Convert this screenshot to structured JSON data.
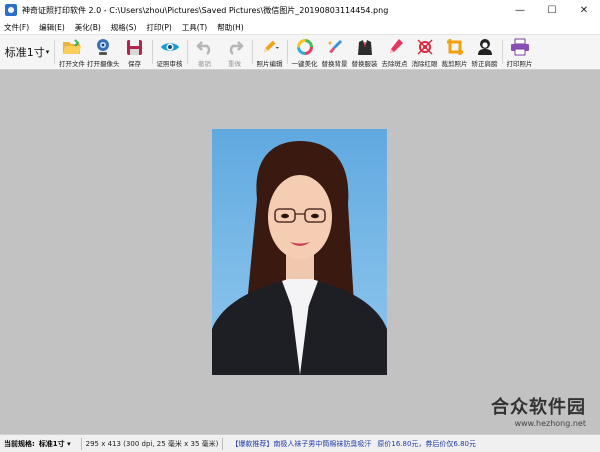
{
  "window": {
    "title": "神奇证照打印软件 2.0 - C:\\Users\\zhou\\Pictures\\Saved Pictures\\微信图片_20190803114454.png",
    "minimize": "—",
    "maximize": "☐",
    "close": "✕"
  },
  "menu": {
    "items": [
      "文件(F)",
      "编辑(E)",
      "美化(B)",
      "规格(S)",
      "打印(P)",
      "工具(T)",
      "帮助(H)"
    ]
  },
  "toolbar": {
    "size_value": "标准1寸",
    "buttons": [
      {
        "label": "打开文件",
        "icon": "folder-open-icon",
        "enabled": true
      },
      {
        "label": "打开摄像头",
        "icon": "webcam-icon",
        "enabled": true
      },
      {
        "label": "保存",
        "icon": "save-disk-icon",
        "enabled": true
      },
      {
        "label": "证照审核",
        "icon": "eye-icon",
        "enabled": true
      },
      {
        "label": "撤销",
        "icon": "undo-icon",
        "enabled": false
      },
      {
        "label": "重做",
        "icon": "redo-icon",
        "enabled": false
      },
      {
        "label": "照片编辑",
        "icon": "pencil-icon",
        "enabled": true
      },
      {
        "label": "一键美化",
        "icon": "color-ring-icon",
        "enabled": true
      },
      {
        "label": "替换背景",
        "icon": "paint-brush-icon",
        "enabled": true
      },
      {
        "label": "替换服装",
        "icon": "suit-icon",
        "enabled": true
      },
      {
        "label": "去除斑点",
        "icon": "pen-icon",
        "enabled": true
      },
      {
        "label": "消除红眼",
        "icon": "red-eye-icon",
        "enabled": true
      },
      {
        "label": "裁剪照片",
        "icon": "crop-icon",
        "enabled": true
      },
      {
        "label": "矫正肩膀",
        "icon": "head-icon",
        "enabled": true
      },
      {
        "label": "打印照片",
        "icon": "printer-icon",
        "enabled": true
      }
    ]
  },
  "watermark": {
    "main": "合众软件园",
    "url": "www.hezhong.net"
  },
  "status": {
    "spec_label": "当前规格:",
    "spec_value": "标准1寸",
    "info": "295 x 413 (300 dpi, 25 毫米 x 35 毫米)",
    "ad": "【爆款推荐】南极人袜子男中筒棉袜防臭吸汗",
    "price": "原价16.80元，券后价仅6.80元"
  },
  "colors": {
    "photo_background": "#6fb4e6",
    "canvas": "#c2c2c2",
    "link": "#1e3aa8"
  }
}
